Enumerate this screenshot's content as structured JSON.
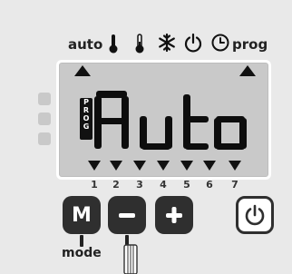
{
  "indicators": {
    "auto_label": "auto",
    "prog_label": "prog",
    "icons": [
      "thermometer-high-icon",
      "thermometer-low-icon",
      "snowflake-icon",
      "standby-icon",
      "clock-icon"
    ]
  },
  "display": {
    "prog_badge": [
      "P",
      "R",
      "O",
      "G"
    ],
    "main_text": "Auto",
    "days": [
      "1",
      "2",
      "3",
      "4",
      "5",
      "6",
      "7"
    ]
  },
  "buttons": {
    "mode_label": "M",
    "mode_caption": "mode",
    "minus_icon": "minus-icon",
    "plus_icon": "plus-icon",
    "power_icon": "power-icon"
  },
  "colors": {
    "background": "#e9e9e9",
    "lcd": "#c9c9c9",
    "ink": "#111111",
    "button": "#2f2f2f"
  }
}
